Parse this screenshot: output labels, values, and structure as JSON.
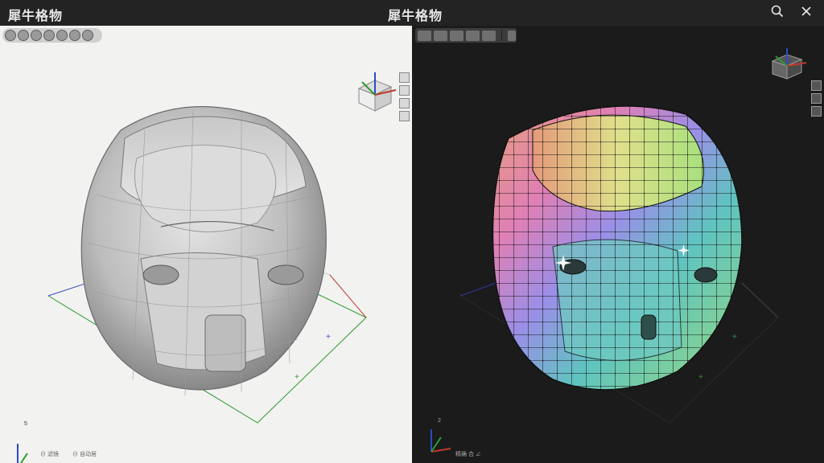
{
  "app": {
    "title_left": "犀牛格物",
    "title_center": "犀牛格物"
  },
  "window_controls": {
    "search_icon": "search-icon",
    "close_icon": "close-icon"
  },
  "left_viewport": {
    "toolbar_icons": [
      "camera-icon",
      "film-icon",
      "folder-icon",
      "info-icon",
      "layers-icon",
      "brush-icon",
      "clock-icon"
    ],
    "side_icons": [
      "view-icon",
      "grid-icon",
      "light-icon",
      "frame-icon"
    ],
    "status_text_1": "⊖ 滤镜",
    "status_text_2": "⊖ 自动居",
    "axis_label": "5"
  },
  "right_viewport": {
    "toolbar_icons": [
      "select-icon",
      "move-icon",
      "frame-icon",
      "snap-icon",
      "brush-icon"
    ],
    "toolbar_extra_icon": "dot-icon",
    "side_icons": [
      "view-icon",
      "grid-icon",
      "close-small-icon"
    ],
    "status_text": "精确 合 ∠",
    "axis_label": "2"
  },
  "colors": {
    "titlebar": "#232323",
    "left_bg": "#f2f2f1",
    "right_bg": "#1b1b1b",
    "axis_x": "#c0392b",
    "axis_y": "#2e9e2e",
    "axis_z": "#2b4bc8"
  }
}
